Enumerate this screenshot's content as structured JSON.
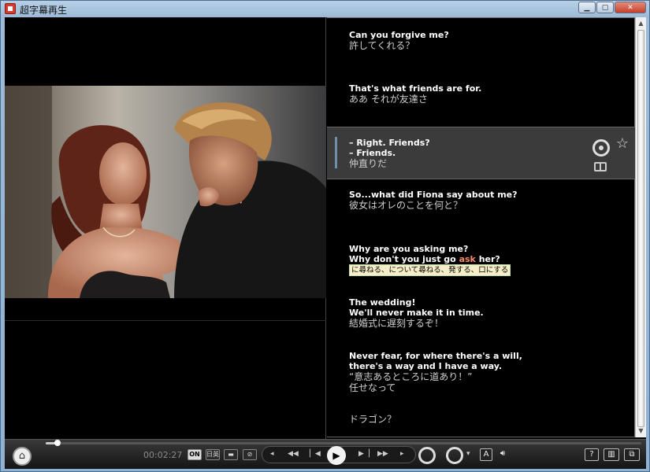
{
  "window": {
    "title": "超字幕再生",
    "min_label": "▁",
    "max_label": "▢",
    "close_label": "✕"
  },
  "subtitles": [
    {
      "en": "Can you forgive me?",
      "jp": "許してくれる？"
    },
    {
      "en": "That's what friends are for.",
      "jp": "ああ それが友達さ"
    },
    {
      "en1": "– Right. Friends?",
      "en2": "– Friends.",
      "jp": "仲直りだ"
    },
    {
      "en": "So...what did Fiona say about me?",
      "jp": "彼女はオレのことを何と？"
    },
    {
      "en1": "Why are you asking me?",
      "en2_pre": "Why don't you just go ",
      "en2_word": "ask",
      "en2_post": " her?",
      "tooltip": "に尋ねる、について尋ねる、発する、口にする"
    },
    {
      "en1": "The wedding!",
      "en2": "We'll never make it in time.",
      "jp": "結婚式に遅刻するぞ！"
    },
    {
      "en1": "Never fear, for where there's a will,",
      "en2": "there's a way and I have a way.",
      "jp1": "“意志あるところに道あり！”",
      "jp2": "任せなって"
    },
    {
      "jp": "ドラゴン？"
    }
  ],
  "controls": {
    "time": "00:02:27",
    "on_label": "ON",
    "en_jp_label": "日英",
    "help_label": "?",
    "font_label": "A",
    "seek_progress": 0.02
  },
  "colors": {
    "highlight_word": "#f58a6a",
    "tooltip_bg": "#f6eec8",
    "active_row": "#3b3b3b"
  }
}
